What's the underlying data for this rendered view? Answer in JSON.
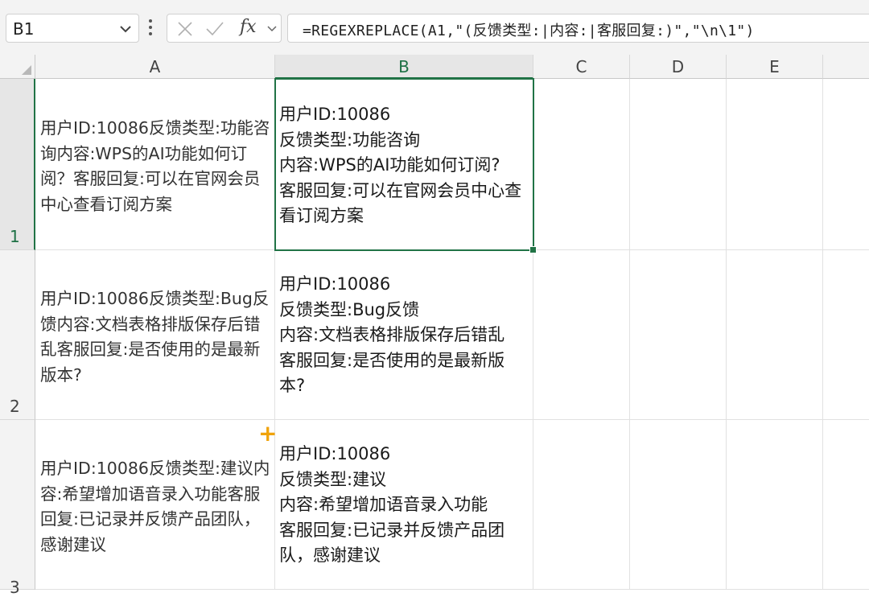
{
  "name_box": {
    "value": "B1"
  },
  "formula_bar": {
    "fx_label": "fx",
    "formula": "=REGEXREPLACE(A1,\"(反馈类型:|内容:|客服回复:)\",\"\\n\\1\")"
  },
  "columns": [
    "A",
    "B",
    "C",
    "D",
    "E"
  ],
  "rows": [
    "1",
    "2",
    "3"
  ],
  "cells": {
    "A1": "用户ID:10086反馈类型:功能咨询内容:WPS的AI功能如何订阅？客服回复:可以在官网会员中心查看订阅方案",
    "B1": "用户ID:10086\n反馈类型:功能咨询\n内容:WPS的AI功能如何订阅?\n客服回复:可以在官网会员中心查看订阅方案",
    "A2": "用户ID:10086反馈类型:Bug反馈内容:文档表格排版保存后错乱客服回复:是否使用的是最新版本?",
    "B2": "用户ID:10086\n反馈类型:Bug反馈\n内容:文档表格排版保存后错乱\n客服回复:是否使用的是最新版本?",
    "A3": "用户ID:10086反馈类型:建议内容:希望增加语音录入功能客服回复:已记录并反馈产品团队，感谢建议",
    "B3": "用户ID:10086\n反馈类型:建议\n内容:希望增加语音录入功能\n客服回复:已记录并反馈产品团队，感谢建议"
  },
  "selected_cell": "B1",
  "colors": {
    "selection": "#217346",
    "fill_handle_plus": "#f0a30a"
  },
  "icons": [
    "chevron-down-icon",
    "more-options-icon",
    "cancel-x-icon",
    "confirm-check-icon",
    "chevron-down-icon"
  ]
}
